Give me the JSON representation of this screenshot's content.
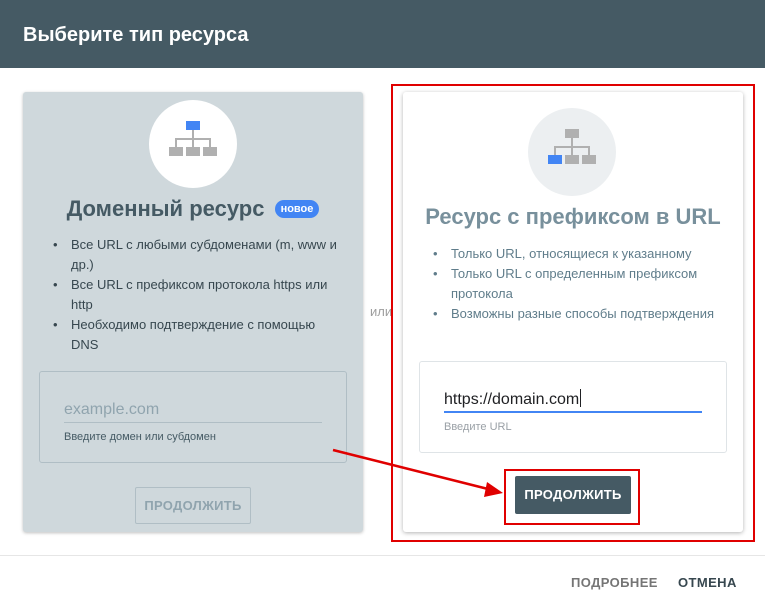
{
  "header": {
    "title": "Выберите тип ресурса"
  },
  "domain_card": {
    "title": "Доменный ресурс",
    "badge": "новое",
    "features": [
      "Все URL с любыми субдоменами (m, www и др.)",
      "Все URL с префиксом протокола https или http",
      "Необходимо подтверждение с помощью DNS"
    ],
    "input_placeholder": "example.com",
    "input_hint": "Введите домен или субдомен",
    "continue_label": "ПРОДОЛЖИТЬ"
  },
  "or_label": "или",
  "url_card": {
    "title": "Ресурс с префиксом в URL",
    "features": [
      "Только URL, относящиеся к указанному",
      "Только URL с определенным префиксом протокола",
      "Возможны разные способы подтверждения"
    ],
    "input_value": "https://domain.com",
    "input_hint": "Введите URL",
    "continue_label": "ПРОДОЛЖИТЬ"
  },
  "footer": {
    "learn_more_label": "ПОДРОБНЕЕ",
    "cancel_label": "ОТМЕНА"
  },
  "colors": {
    "header_bg": "#455a64",
    "accent_blue": "#4285f4",
    "highlight_red": "#e00000",
    "domain_card_bg": "#cfd8dc"
  },
  "icons": {
    "domain": "sitemap-icon",
    "url_prefix": "sitemap-icon"
  }
}
